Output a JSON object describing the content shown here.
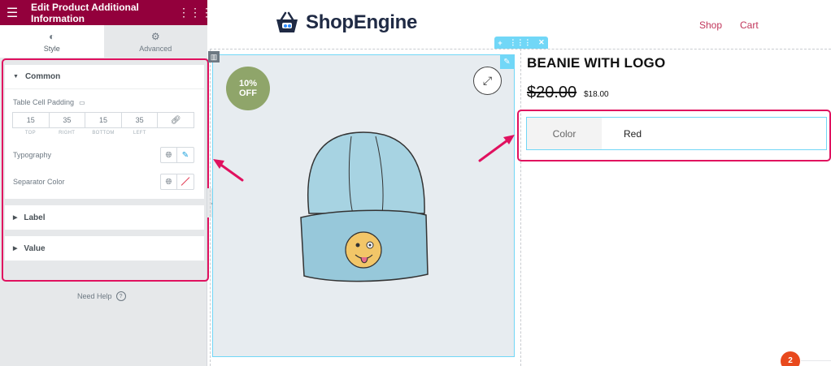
{
  "editor": {
    "title": "Edit Product Additional Information",
    "tabs": [
      {
        "label": "Style",
        "icon": "half-circle-icon"
      },
      {
        "label": "Advanced",
        "icon": "gear-icon"
      }
    ],
    "common": {
      "heading": "Common",
      "cell_padding_label": "Table Cell Padding",
      "padding": {
        "top": "15",
        "right": "35",
        "bottom": "15",
        "left": "35"
      },
      "padding_labels": {
        "top": "TOP",
        "right": "RIGHT",
        "bottom": "BOTTOM",
        "left": "LEFT"
      },
      "typography_label": "Typography",
      "separator_label": "Separator Color"
    },
    "label_section": "Label",
    "value_section": "Value",
    "need_help": "Need Help",
    "help_glyph": "?"
  },
  "site": {
    "logo_text": "ShopEngine",
    "nav": [
      "Shop",
      "Cart"
    ]
  },
  "product": {
    "badge_line1": "10%",
    "badge_line2": "OFF",
    "title": "BEANIE WITH LOGO",
    "price_old": "$20.00",
    "price_new": "$18.00",
    "attribute_label": "Color",
    "attribute_value": "Red"
  },
  "notification_count": "2",
  "colors": {
    "header": "#93003c",
    "accent": "#71d7f7",
    "highlight": "#e0115f",
    "nav": "#c1365b",
    "badge": "#8fa56a"
  }
}
